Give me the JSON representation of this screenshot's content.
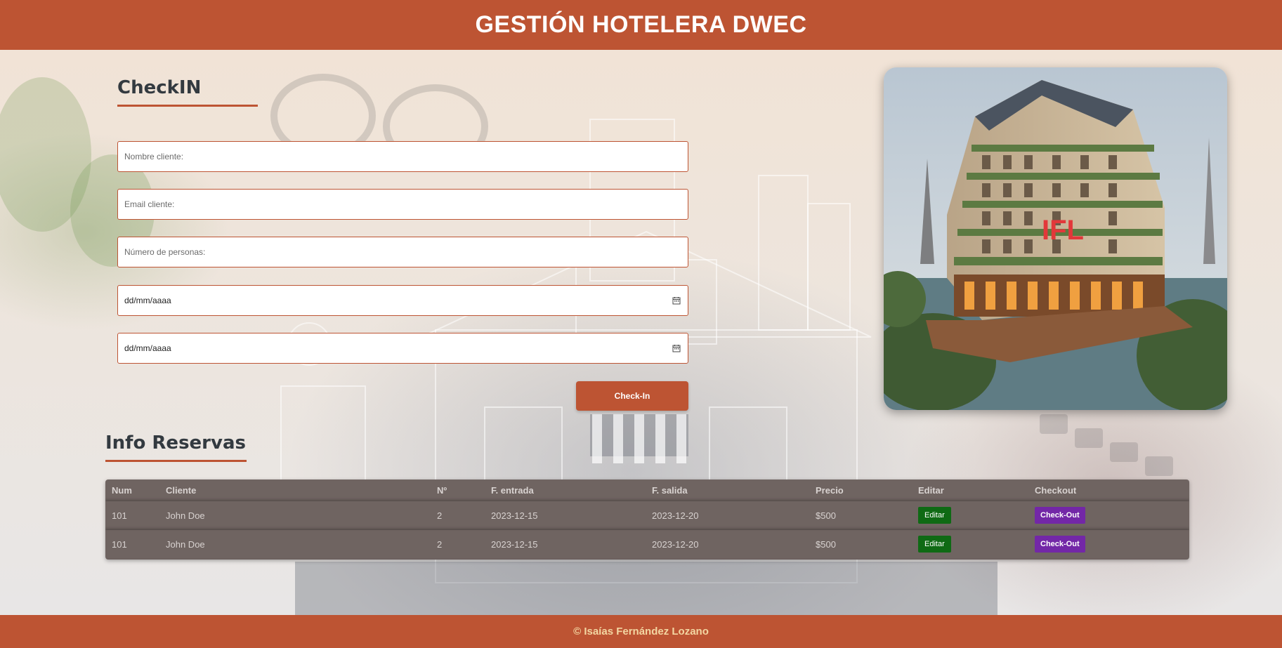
{
  "header": {
    "title": "GESTIÓN HOTELERA DWEC"
  },
  "checkin": {
    "title": "CheckIN",
    "fields": {
      "nombre_placeholder": "Nombre cliente:",
      "email_placeholder": "Email cliente:",
      "personas_placeholder": "Número de personas:",
      "fecha_entrada_value": "dd/mm/aaaa",
      "fecha_salida_value": "dd/mm/aaaa"
    },
    "button_label": "Check-In"
  },
  "hotel_image": {
    "sign_text": "IFL",
    "description_icon": "hotel-photo"
  },
  "reservas": {
    "title": "Info Reservas",
    "columns": [
      "Num",
      "Cliente",
      "Nº",
      "F. entrada",
      "F. salida",
      "Precio",
      "Editar",
      "Checkout"
    ],
    "rows": [
      {
        "num": "101",
        "cliente": "John Doe",
        "n": "2",
        "entrada": "2023-12-15",
        "salida": "2023-12-20",
        "precio": "$500",
        "editar": "Editar",
        "checkout": "Check-Out"
      },
      {
        "num": "101",
        "cliente": "John Doe",
        "n": "2",
        "entrada": "2023-12-15",
        "salida": "2023-12-20",
        "precio": "$500",
        "editar": "Editar",
        "checkout": "Check-Out"
      }
    ]
  },
  "footer": {
    "text": "© Isaías Fernández Lozano"
  },
  "colors": {
    "primary": "#bd5433",
    "table_bg": "#6f6461",
    "edit_button": "#0f6a14",
    "checkout_button": "#7327a7",
    "footer_text": "#f3d6a2"
  }
}
